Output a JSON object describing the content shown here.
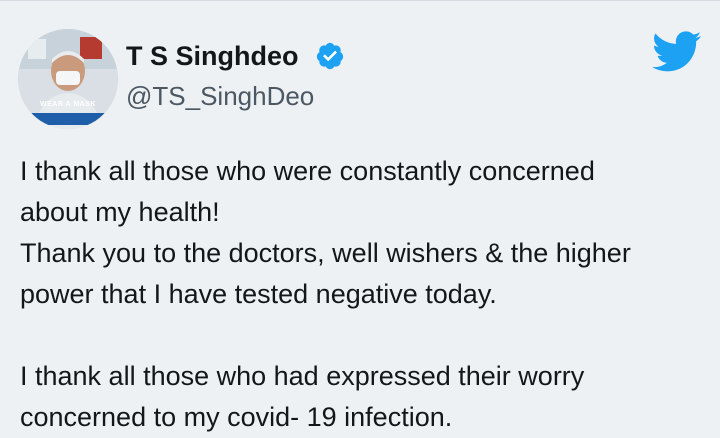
{
  "author": {
    "display_name": "T S Singhdeo",
    "handle": "@TS_SinghDeo",
    "avatar_caption": "WEAR A MASK",
    "verified": true,
    "verified_color": "#1da1f2",
    "avatar_icon": "profile-photo",
    "brand_icon": "twitter-bird-icon",
    "brand_color": "#1da1f2"
  },
  "tweet": {
    "lines": [
      "I thank all those who were constantly concerned",
      "about my health!",
      "Thank you to the doctors, well wishers & the higher",
      "power that I have tested negative today.",
      "",
      "I thank all those who had expressed their worry",
      "concerned to my covid- 19 infection."
    ]
  }
}
